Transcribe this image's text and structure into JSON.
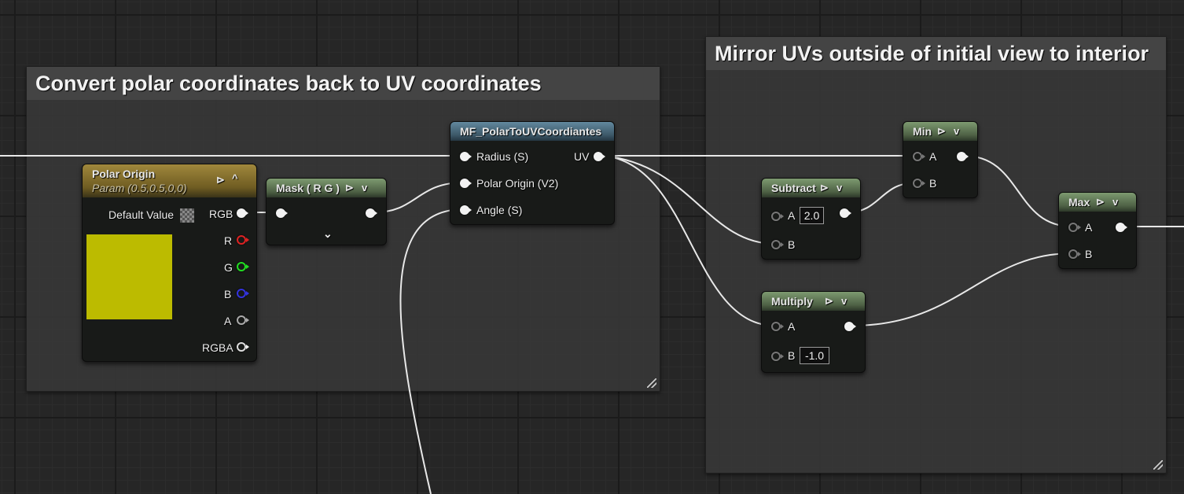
{
  "comments": {
    "left": {
      "title": "Convert polar coordinates back to UV coordinates"
    },
    "right": {
      "title": "Mirror UVs outside of initial view to interior"
    }
  },
  "nodes": {
    "polar_origin": {
      "title": "Polar Origin",
      "subtitle": "Param (0.5,0.5,0,0)",
      "default_value_label": "Default Value",
      "swatch_color": "#bcbb00",
      "pins": {
        "rgb": "RGB",
        "r": "R",
        "g": "G",
        "b": "B",
        "a": "A",
        "rgba": "RGBA"
      }
    },
    "mask": {
      "title": "Mask ( R G )"
    },
    "mf_polar": {
      "title": "MF_PolarToUVCoordiantes",
      "inputs": {
        "radius": "Radius (S)",
        "polar_origin": "Polar Origin (V2)",
        "angle": "Angle (S)"
      },
      "output": "UV"
    },
    "subtract": {
      "title": "Subtract",
      "pin_a": "A",
      "pin_a_value": "2.0",
      "pin_b": "B"
    },
    "multiply": {
      "title": "Multiply",
      "pin_a": "A",
      "pin_b": "B",
      "pin_b_value": "-1.0"
    },
    "min": {
      "title": "Min",
      "pin_a": "A",
      "pin_b": "B"
    },
    "max": {
      "title": "Max",
      "pin_a": "A",
      "pin_b": "B"
    }
  },
  "icons": {
    "preview": "play-circle-icon",
    "collapse": "chevron-up-icon",
    "expand": "chevron-down-icon"
  }
}
